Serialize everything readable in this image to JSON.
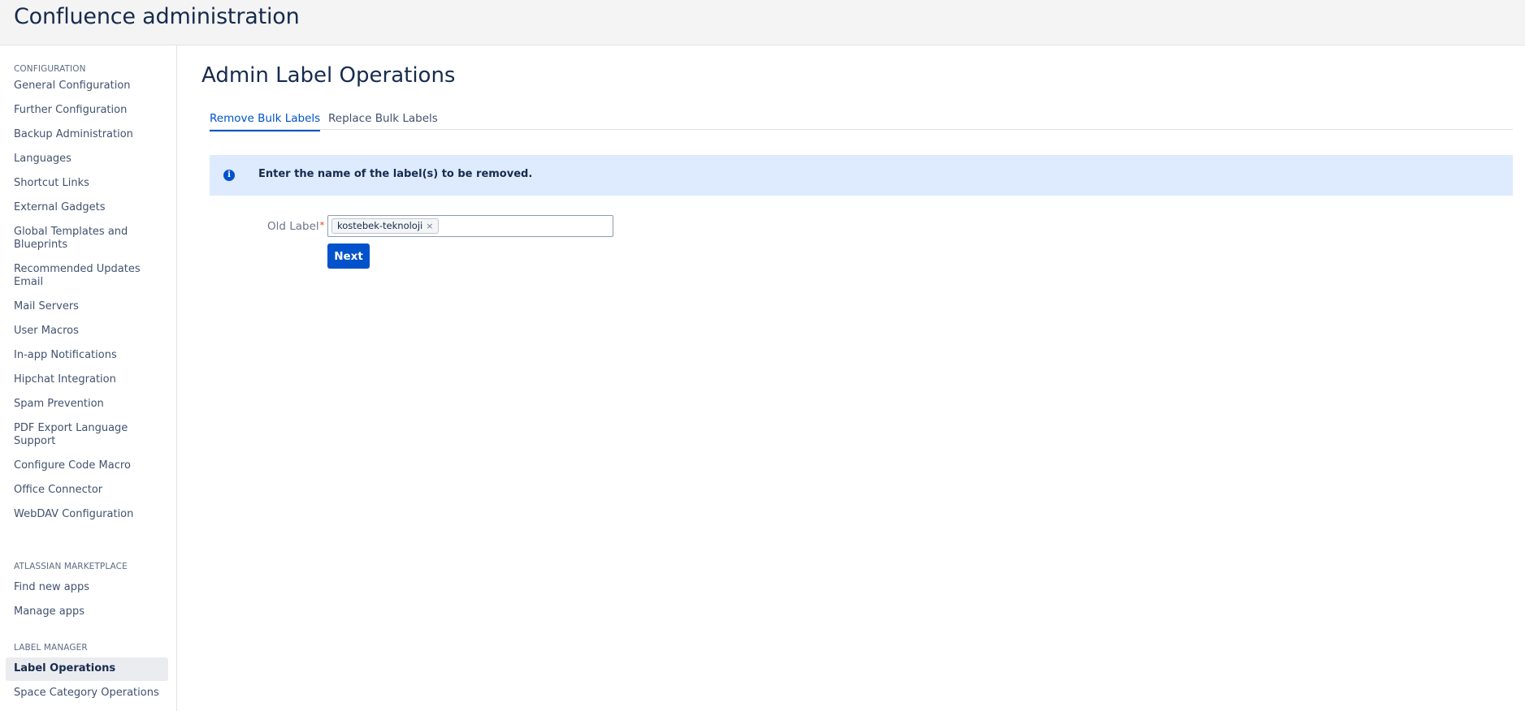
{
  "header": {
    "title": "Confluence administration"
  },
  "sidebar": {
    "sections": [
      {
        "heading": "CONFIGURATION",
        "items": [
          "General Configuration",
          "Further Configuration",
          "Backup Administration",
          "Languages",
          "Shortcut Links",
          "External Gadgets",
          "Global Templates and Blueprints",
          "Recommended Updates Email",
          "Mail Servers",
          "User Macros",
          "In-app Notifications",
          "Hipchat Integration",
          "Spam Prevention",
          "PDF Export Language Support",
          "Configure Code Macro",
          "Office Connector",
          "WebDAV Configuration"
        ]
      },
      {
        "heading": "ATLASSIAN MARKETPLACE",
        "items": [
          "Find new apps",
          "Manage apps"
        ]
      },
      {
        "heading": "LABEL MANAGER",
        "items": [
          "Label Operations",
          "Space Category Operations"
        ]
      }
    ],
    "active_item": "Label Operations"
  },
  "main": {
    "title": "Admin Label Operations",
    "tabs": [
      {
        "label": "Remove Bulk Labels",
        "active": true
      },
      {
        "label": "Replace Bulk Labels",
        "active": false
      }
    ],
    "info": {
      "icon": "info-circle-icon",
      "text": "Enter the name of the label(s) to be removed."
    },
    "form": {
      "old_label": {
        "label": "Old Label",
        "required_marker": "*",
        "tags": [
          "kostebek-teknoloji"
        ],
        "remove_glyph": "×"
      },
      "next_label": "Next"
    }
  },
  "colors": {
    "accent": "#0052cc",
    "info_bg": "#deebff",
    "header_bg": "#f4f4f4",
    "required": "#de350b"
  }
}
